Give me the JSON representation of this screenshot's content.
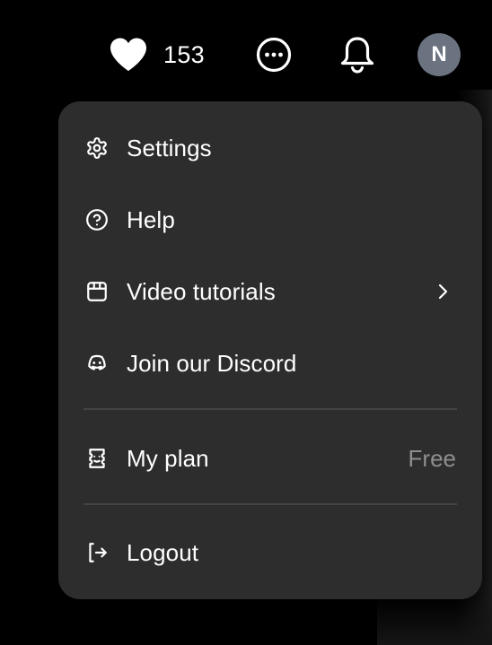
{
  "header": {
    "likes_count": "153",
    "avatar_initial": "N"
  },
  "menu": {
    "settings": "Settings",
    "help": "Help",
    "video_tutorials": "Video tutorials",
    "discord": "Join our Discord",
    "my_plan": "My plan",
    "plan_value": "Free",
    "logout": "Logout"
  },
  "icons": {
    "likes": "heart-icon",
    "more": "more-horizontal-icon",
    "notifications": "bell-icon",
    "settings": "gear-icon",
    "help": "help-circle-icon",
    "video": "clapperboard-icon",
    "discord": "discord-icon",
    "plan": "ticket-icon",
    "logout": "logout-icon",
    "submenu": "chevron-right-icon"
  },
  "colors": {
    "background": "#000000",
    "menu_background": "#2d2d2d",
    "avatar": "#6b7280",
    "muted_text": "#8e8e8e"
  }
}
